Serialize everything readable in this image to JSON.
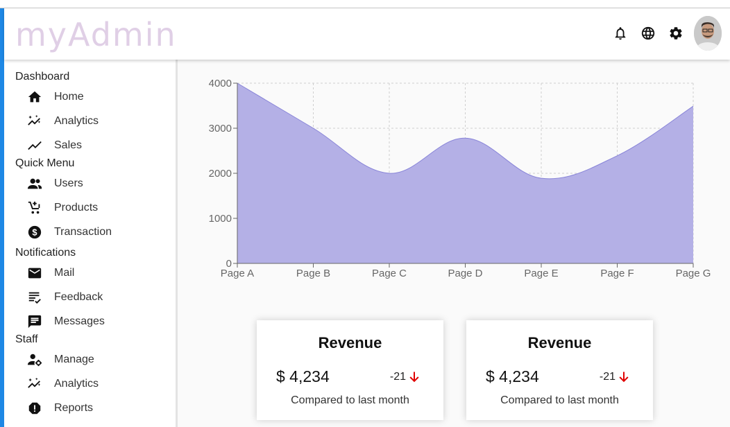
{
  "app": {
    "logo": "myAdmin"
  },
  "topbar": {
    "icons": [
      "bell-icon",
      "globe-icon",
      "settings-icon"
    ],
    "avatar": "user-avatar"
  },
  "sidebar": {
    "sections": [
      {
        "title": "Dashboard",
        "items": [
          {
            "label": "Home",
            "icon": "home-icon"
          },
          {
            "label": "Analytics",
            "icon": "analytics-icon"
          },
          {
            "label": "Sales",
            "icon": "trending-icon"
          }
        ]
      },
      {
        "title": "Quick Menu",
        "items": [
          {
            "label": "Users",
            "icon": "users-icon"
          },
          {
            "label": "Products",
            "icon": "cart-icon"
          },
          {
            "label": "Transaction",
            "icon": "dollar-icon"
          }
        ]
      },
      {
        "title": "Notifications",
        "items": [
          {
            "label": "Mail",
            "icon": "mail-icon"
          },
          {
            "label": "Feedback",
            "icon": "feedback-icon"
          },
          {
            "label": "Messages",
            "icon": "message-icon"
          }
        ]
      },
      {
        "title": "Staff",
        "items": [
          {
            "label": "Manage",
            "icon": "manage-icon"
          },
          {
            "label": "Analytics",
            "icon": "analytics-icon"
          },
          {
            "label": "Reports",
            "icon": "report-icon"
          }
        ]
      }
    ]
  },
  "chart_data": {
    "type": "area",
    "categories": [
      "Page A",
      "Page B",
      "Page C",
      "Page D",
      "Page E",
      "Page F",
      "Page G"
    ],
    "series": [
      {
        "values": [
          4000,
          3000,
          2000,
          2780,
          1890,
          2390,
          3490
        ]
      }
    ],
    "title": "",
    "xlabel": "",
    "ylabel": "",
    "ylim": [
      0,
      4000
    ],
    "yticks": [
      0,
      1000,
      2000,
      3000,
      4000
    ],
    "grid": true,
    "fill_color": "#b4b0e6",
    "stroke_color": "#8884d8"
  },
  "cards": [
    {
      "title": "Revenue",
      "money": "$ 4,234",
      "rate": "-21",
      "subtitle": "Compared to last month"
    },
    {
      "title": "Revenue",
      "money": "$ 4,234",
      "rate": "-21",
      "subtitle": "Compared to last month"
    }
  ],
  "colors": {
    "down_arrow": "#e00000",
    "logo": "#e0cfe6"
  }
}
